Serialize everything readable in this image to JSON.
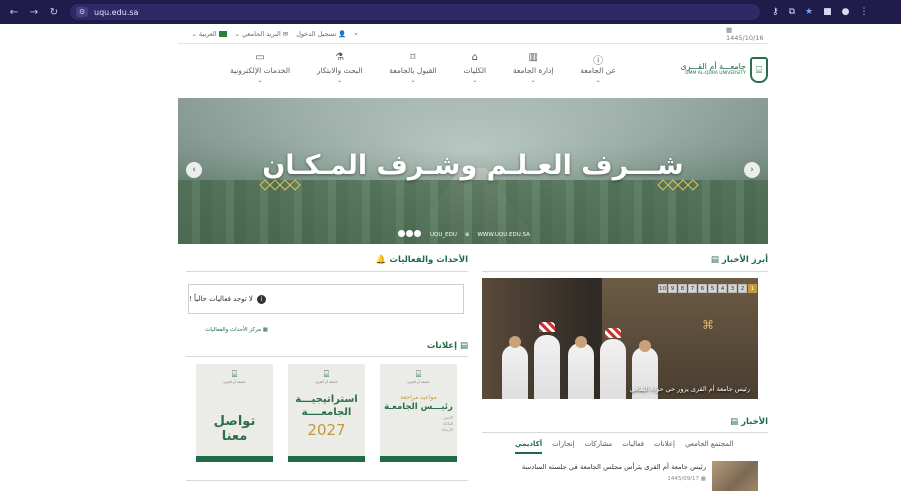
{
  "browser": {
    "url": "uqu.edu.sa"
  },
  "topbar": {
    "date": "1445/10/16",
    "login": "تسجيل الدخول",
    "email": "البريد الجامعي",
    "language": "العربية"
  },
  "logo": {
    "ar": "جامعـــة أم القـــرى",
    "en": "UMM AL-QURA UNIVERSITY"
  },
  "nav": [
    {
      "label": "عن الجامعة",
      "icon": "info-icon"
    },
    {
      "label": "إدارة الجامعة",
      "icon": "building-icon"
    },
    {
      "label": "الكليات",
      "icon": "columns-icon"
    },
    {
      "label": "القبول بالجامعة",
      "icon": "graduation-cap-icon"
    },
    {
      "label": "البحث والابتكار",
      "icon": "flask-icon"
    },
    {
      "label": "الخدمات الإلكترونية",
      "icon": "laptop-icon"
    }
  ],
  "hero": {
    "title": "شـــرف العـلـم وشـرف المـكـان",
    "handle": "UQU_EDU",
    "website": "WWW.UQU.EDU.SA"
  },
  "events": {
    "title": "الأحداث والفعاليات",
    "empty_message": "لا توجد فعاليات حالياً !",
    "center_link": "مركز الأحداث والفعاليات"
  },
  "announcements": {
    "title": "إعلانات",
    "cards": [
      {
        "brand": "جامعة أم القرى",
        "line1": "مواعيد مراجعة",
        "line2": "رئيـــس الجامعـة",
        "details": [
          "الاثنين",
          "الثلاثاء",
          "الأربعاء"
        ]
      },
      {
        "brand": "جامعة أم القرى",
        "line1": "استراتيجيـــة",
        "line2": "الجامعــــة",
        "year": "2027"
      },
      {
        "brand": "جامعة أم القرى",
        "line1": "تواصل معنا"
      }
    ]
  },
  "top_news": {
    "title": "أبرز الأخبار",
    "caption": "رئيس جامعة أم القرى يزور حي حراء الثقافي",
    "pager": [
      "1",
      "2",
      "3",
      "4",
      "5",
      "6",
      "7",
      "8",
      "9",
      "10"
    ],
    "active_page": "1"
  },
  "news": {
    "title": "الأخبار",
    "tabs": [
      "أكاديمي",
      "إنجازات",
      "مشاركات",
      "فعاليات",
      "إعلانات",
      "المجتمع الجامعي"
    ],
    "active_tab": "أكاديمي",
    "item": {
      "title": "رئيس جامعة أم القرى يترأس مجلس الجامعة في جلسته السادسة",
      "date": "1445/09/17"
    }
  },
  "colors": {
    "brand_green": "#1f6b46",
    "gold": "#c49a3a",
    "chrome_bg": "#1f1b4a"
  }
}
